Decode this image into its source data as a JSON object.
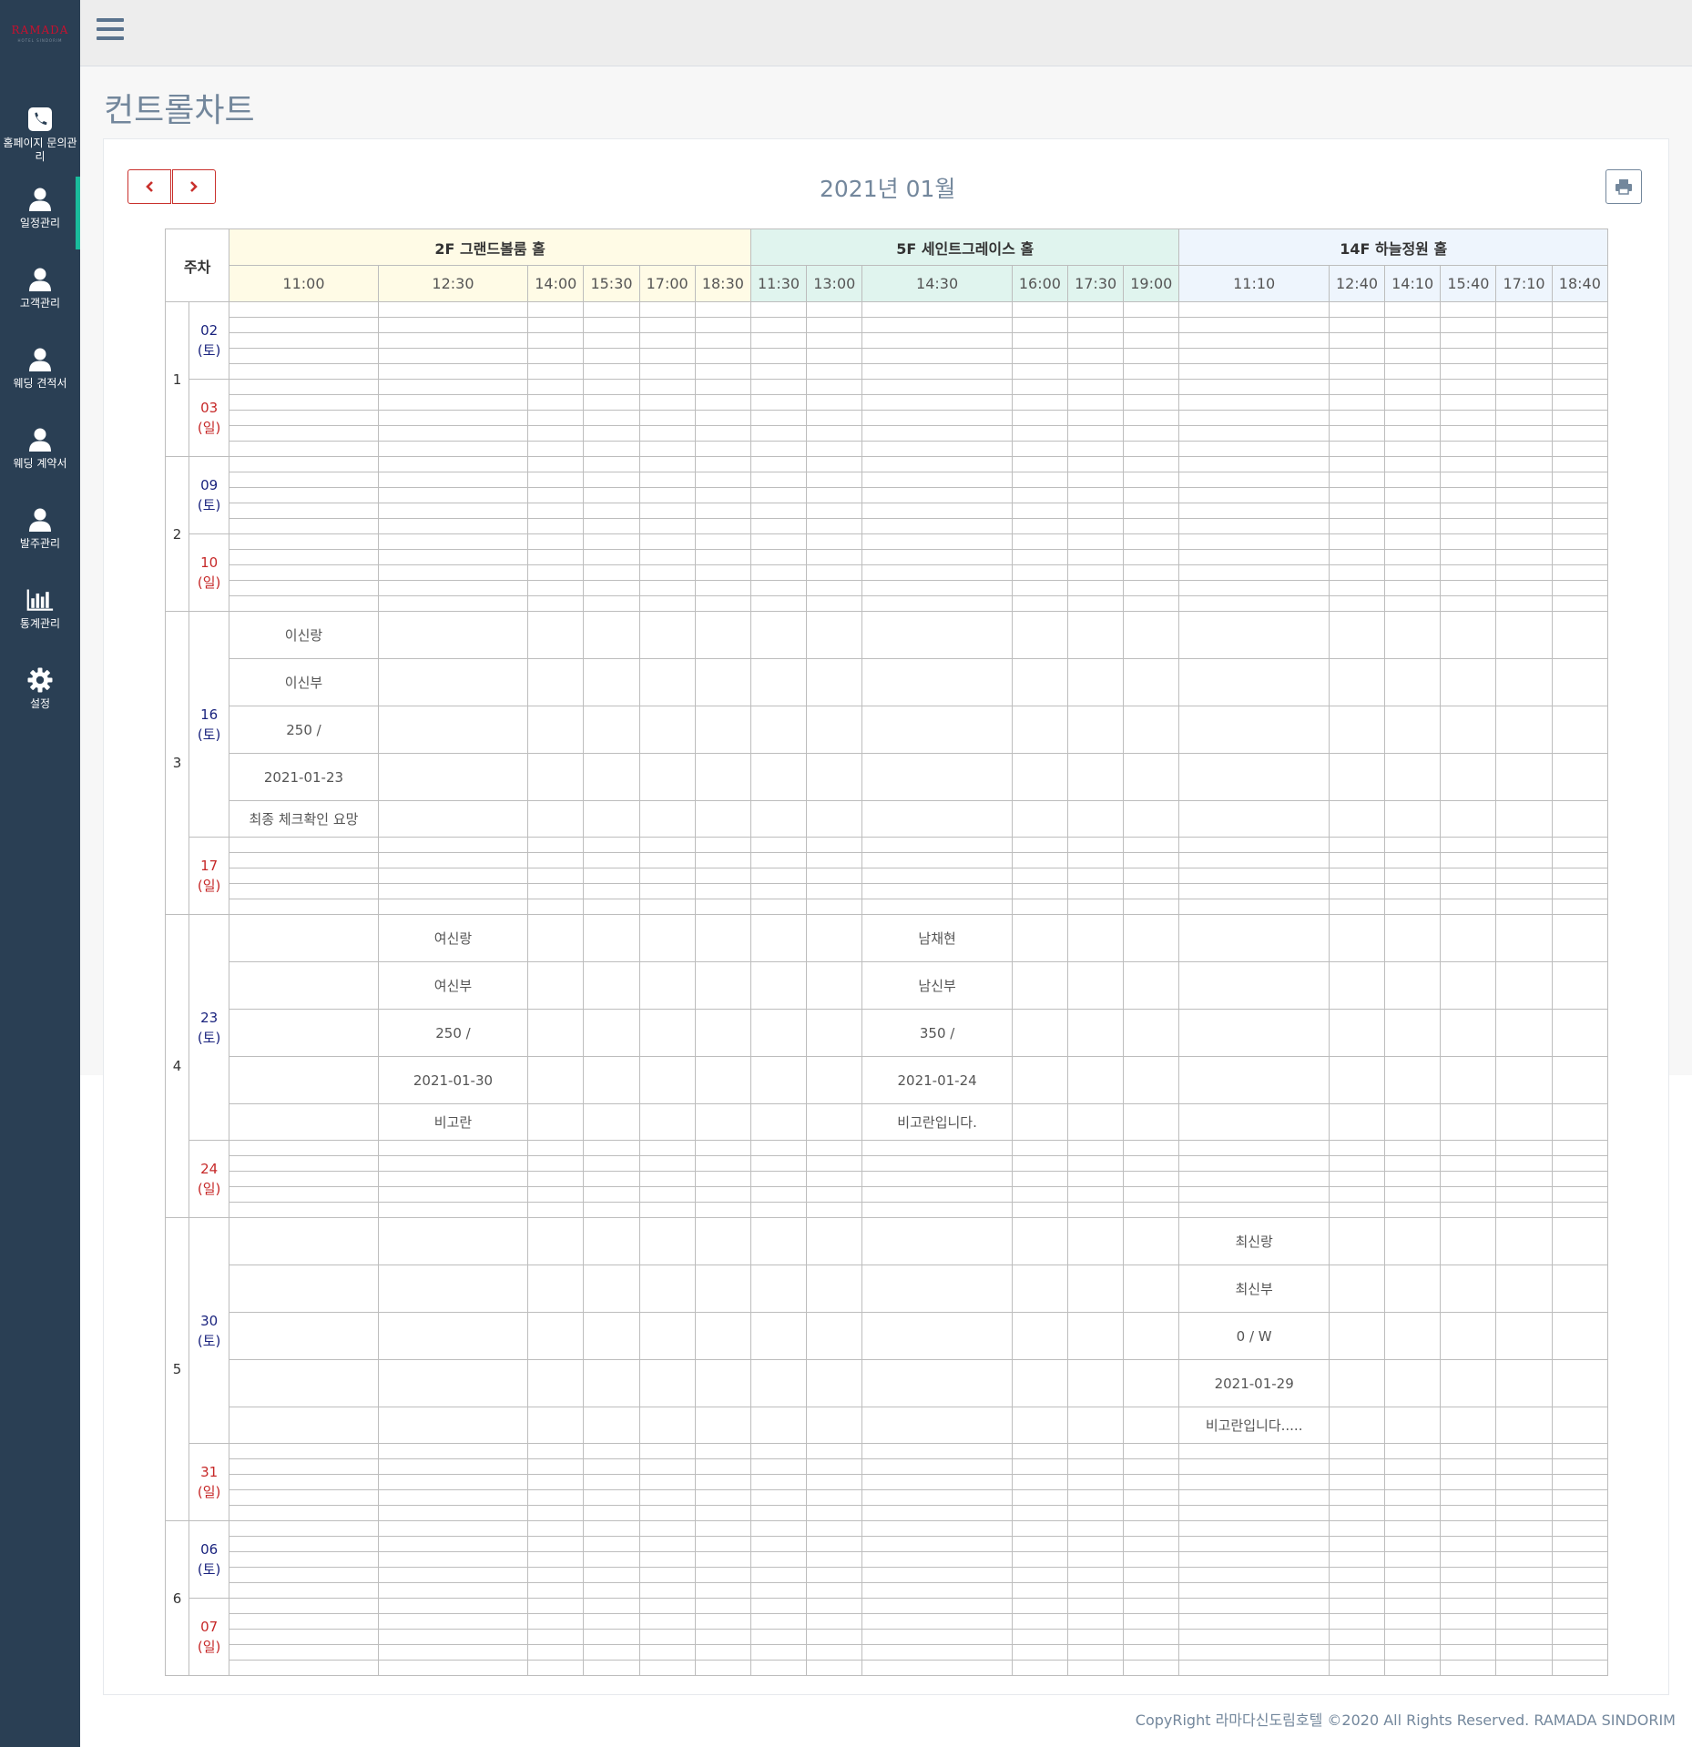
{
  "app": {
    "logo": "RAMADA",
    "logo_sub": "HOTEL SINDORIM"
  },
  "sidebar": {
    "items": [
      {
        "icon": "phone-icon",
        "label": "홈페이지 문의관리"
      },
      {
        "icon": "user-icon",
        "label": "일정관리"
      },
      {
        "icon": "user-icon",
        "label": "고객관리"
      },
      {
        "icon": "user-icon",
        "label": "웨딩 견적서"
      },
      {
        "icon": "user-icon",
        "label": "웨딩 계약서"
      },
      {
        "icon": "user-icon",
        "label": "발주관리"
      },
      {
        "icon": "bar-chart-icon",
        "label": "통계관리"
      },
      {
        "icon": "gear-icon",
        "label": "설정"
      }
    ]
  },
  "page": {
    "title": "컨트롤차트",
    "month": "2021년 01월"
  },
  "table": {
    "week_header": "주차",
    "halls": [
      {
        "name": "2F 그랜드볼룸 홀",
        "color": "#fffbe6",
        "times": [
          "11:00",
          "12:30",
          "14:00",
          "15:30",
          "17:00",
          "18:30"
        ]
      },
      {
        "name": "5F 세인트그레이스 홀",
        "color": "#e0f4ee",
        "times": [
          "11:30",
          "13:00",
          "14:30",
          "16:00",
          "17:30",
          "19:00"
        ]
      },
      {
        "name": "14F 하늘정원 홀",
        "color": "#eef5fd",
        "times": [
          "11:10",
          "12:40",
          "14:10",
          "15:40",
          "17:10",
          "18:40"
        ]
      }
    ],
    "weeks": [
      {
        "week": "1",
        "days": [
          {
            "date": "02",
            "dow": "(토)",
            "type": "sat"
          },
          {
            "date": "03",
            "dow": "(일)",
            "type": "sun"
          }
        ]
      },
      {
        "week": "2",
        "days": [
          {
            "date": "09",
            "dow": "(토)",
            "type": "sat"
          },
          {
            "date": "10",
            "dow": "(일)",
            "type": "sun"
          }
        ]
      },
      {
        "week": "3",
        "days": [
          {
            "date": "16",
            "dow": "(토)",
            "type": "sat"
          },
          {
            "date": "17",
            "dow": "(일)",
            "type": "sun"
          }
        ]
      },
      {
        "week": "4",
        "days": [
          {
            "date": "23",
            "dow": "(토)",
            "type": "sat"
          },
          {
            "date": "24",
            "dow": "(일)",
            "type": "sun"
          }
        ]
      },
      {
        "week": "5",
        "days": [
          {
            "date": "30",
            "dow": "(토)",
            "type": "sat"
          },
          {
            "date": "31",
            "dow": "(일)",
            "type": "sun"
          }
        ]
      },
      {
        "week": "6",
        "days": [
          {
            "date": "06",
            "dow": "(토)",
            "type": "sat"
          },
          {
            "date": "07",
            "dow": "(일)",
            "type": "sun"
          }
        ]
      }
    ],
    "events": [
      {
        "week": 2,
        "day": 0,
        "col": 0,
        "lines": [
          "이신랑",
          "이신부",
          "250 /",
          "2021-01-23",
          "최종 체크확인 요망"
        ]
      },
      {
        "week": 3,
        "day": 0,
        "col": 1,
        "lines": [
          "여신랑",
          "여신부",
          "250 /",
          "2021-01-30",
          "비고란"
        ]
      },
      {
        "week": 3,
        "day": 0,
        "col": 8,
        "lines": [
          "남채현",
          "남신부",
          "350 /",
          "2021-01-24",
          "비고란입니다."
        ]
      },
      {
        "week": 4,
        "day": 0,
        "col": 12,
        "lines": [
          "최신랑",
          "최신부",
          "0 / W",
          "2021-01-29",
          "비고란입니다....."
        ]
      }
    ]
  },
  "footer": {
    "text": "CopyRight 라마다신도림호텔 ©2020 All Rights Reserved. RAMADA SINDORIM"
  }
}
